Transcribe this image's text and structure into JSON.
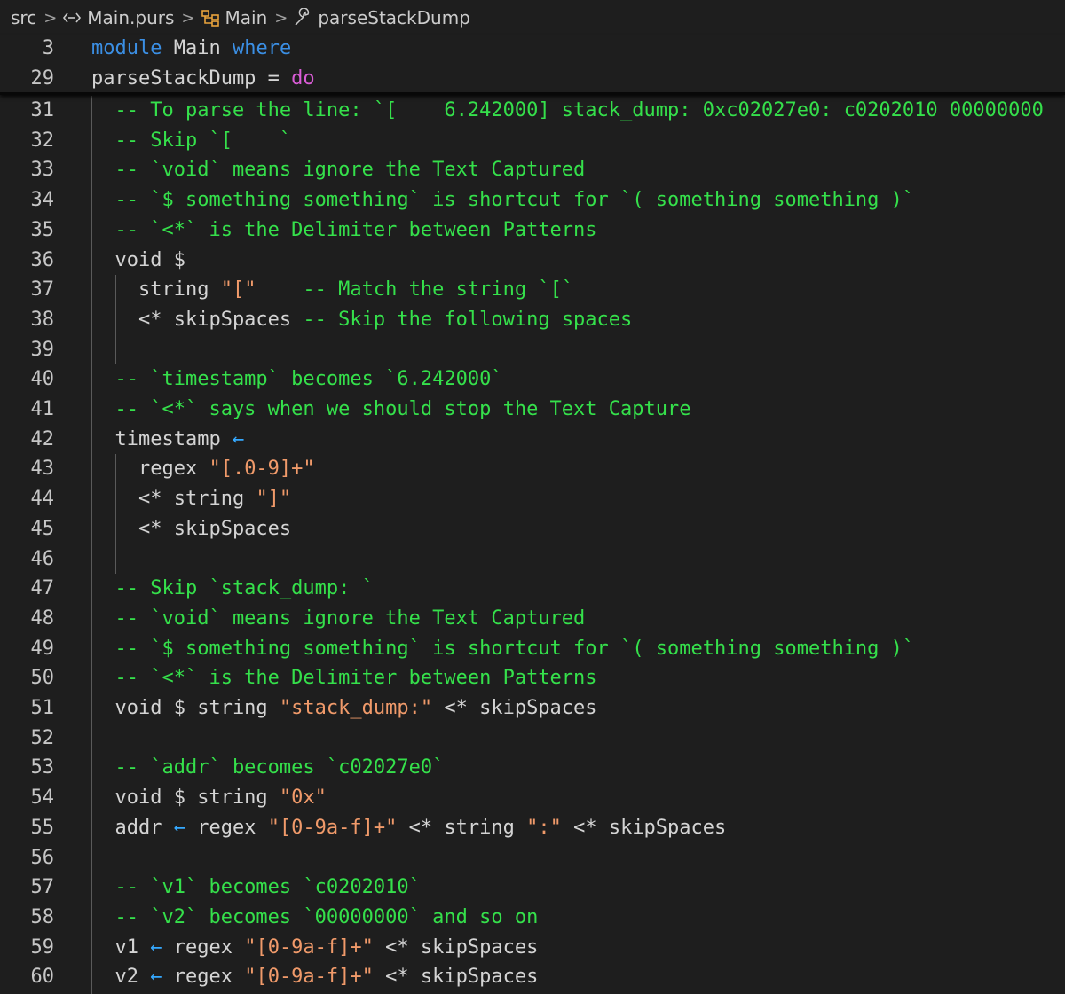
{
  "breadcrumb": {
    "items": [
      {
        "label": "src",
        "icon": "none"
      },
      {
        "label": "Main.purs",
        "icon": "file-code-icon"
      },
      {
        "label": "Main",
        "icon": "module-icon"
      },
      {
        "label": "parseStackDump",
        "icon": "wrench-icon"
      }
    ],
    "separator": ">"
  },
  "editor": {
    "language": "PureScript",
    "file": "Main.purs",
    "sticky_lines": [
      {
        "number": "3",
        "segments": [
          [
            "k",
            "module"
          ],
          [
            "t",
            " Main "
          ],
          [
            "k",
            "where"
          ]
        ]
      },
      {
        "number": "29",
        "segments": [
          [
            "t",
            "parseStackDump = "
          ],
          [
            "d",
            "do"
          ]
        ]
      }
    ],
    "lines": [
      {
        "number": "31",
        "segments": [
          [
            "c",
            "  -- To parse the line: `[    6.242000] stack_dump: 0xc02027e0: c0202010 00000000"
          ]
        ]
      },
      {
        "number": "32",
        "segments": [
          [
            "c",
            "  -- Skip `[    `"
          ]
        ]
      },
      {
        "number": "33",
        "segments": [
          [
            "c",
            "  -- `void` means ignore the Text Captured"
          ]
        ]
      },
      {
        "number": "34",
        "segments": [
          [
            "c",
            "  -- `$ something something` is shortcut for `( something something )`"
          ]
        ]
      },
      {
        "number": "35",
        "segments": [
          [
            "c",
            "  -- `<*` is the Delimiter between Patterns"
          ]
        ]
      },
      {
        "number": "36",
        "segments": [
          [
            "t",
            "  void $"
          ]
        ]
      },
      {
        "number": "37",
        "segments": [
          [
            "t",
            "    string "
          ],
          [
            "s",
            "\"[\""
          ],
          [
            "c",
            "    -- Match the string `[`"
          ]
        ]
      },
      {
        "number": "38",
        "segments": [
          [
            "t",
            "    <* skipSpaces "
          ],
          [
            "c",
            "-- Skip the following spaces"
          ]
        ]
      },
      {
        "number": "39",
        "segments": []
      },
      {
        "number": "40",
        "segments": [
          [
            "c",
            "  -- `timestamp` becomes `6.242000`"
          ]
        ]
      },
      {
        "number": "41",
        "segments": [
          [
            "c",
            "  -- `<*` says when we should stop the Text Capture"
          ]
        ]
      },
      {
        "number": "42",
        "segments": [
          [
            "t",
            "  timestamp "
          ],
          [
            "a",
            "←"
          ]
        ]
      },
      {
        "number": "43",
        "segments": [
          [
            "t",
            "    regex "
          ],
          [
            "s",
            "\"[.0-9]+\""
          ]
        ]
      },
      {
        "number": "44",
        "segments": [
          [
            "t",
            "    <* string "
          ],
          [
            "s",
            "\"]\""
          ]
        ]
      },
      {
        "number": "45",
        "segments": [
          [
            "t",
            "    <* skipSpaces"
          ]
        ]
      },
      {
        "number": "46",
        "segments": []
      },
      {
        "number": "47",
        "segments": [
          [
            "c",
            "  -- Skip `stack_dump: `"
          ]
        ]
      },
      {
        "number": "48",
        "segments": [
          [
            "c",
            "  -- `void` means ignore the Text Captured"
          ]
        ]
      },
      {
        "number": "49",
        "segments": [
          [
            "c",
            "  -- `$ something something` is shortcut for `( something something )`"
          ]
        ]
      },
      {
        "number": "50",
        "segments": [
          [
            "c",
            "  -- `<*` is the Delimiter between Patterns"
          ]
        ]
      },
      {
        "number": "51",
        "segments": [
          [
            "t",
            "  void $ string "
          ],
          [
            "s",
            "\"stack_dump:\""
          ],
          [
            "t",
            " <* skipSpaces"
          ]
        ]
      },
      {
        "number": "52",
        "segments": []
      },
      {
        "number": "53",
        "segments": [
          [
            "c",
            "  -- `addr` becomes `c02027e0`"
          ]
        ]
      },
      {
        "number": "54",
        "segments": [
          [
            "t",
            "  void $ string "
          ],
          [
            "s",
            "\"0x\""
          ]
        ]
      },
      {
        "number": "55",
        "segments": [
          [
            "t",
            "  addr "
          ],
          [
            "a",
            "←"
          ],
          [
            "t",
            " regex "
          ],
          [
            "s",
            "\"[0-9a-f]+\""
          ],
          [
            "t",
            " <* string "
          ],
          [
            "s",
            "\":\""
          ],
          [
            "t",
            " <* skipSpaces"
          ]
        ]
      },
      {
        "number": "56",
        "segments": []
      },
      {
        "number": "57",
        "segments": [
          [
            "c",
            "  -- `v1` becomes `c0202010`"
          ]
        ]
      },
      {
        "number": "58",
        "segments": [
          [
            "c",
            "  -- `v2` becomes `00000000` and so on"
          ]
        ]
      },
      {
        "number": "59",
        "segments": [
          [
            "t",
            "  v1 "
          ],
          [
            "a",
            "←"
          ],
          [
            "t",
            " regex "
          ],
          [
            "s",
            "\"[0-9a-f]+\""
          ],
          [
            "t",
            " <* skipSpaces"
          ]
        ]
      },
      {
        "number": "60",
        "segments": [
          [
            "t",
            "  v2 "
          ],
          [
            "a",
            "←"
          ],
          [
            "t",
            " regex "
          ],
          [
            "s",
            "\"[0-9a-f]+\""
          ],
          [
            "t",
            " <* skipSpaces"
          ]
        ]
      }
    ]
  },
  "colors": {
    "background": "#1e1e1e",
    "comment": "#35e04b",
    "keyword": "#3b8fe4",
    "do_keyword": "#d95cd6",
    "string": "#f09a6a",
    "arrow": "#35a9ff",
    "text": "#d4d4d4",
    "line_number": "#c6c6c6"
  }
}
